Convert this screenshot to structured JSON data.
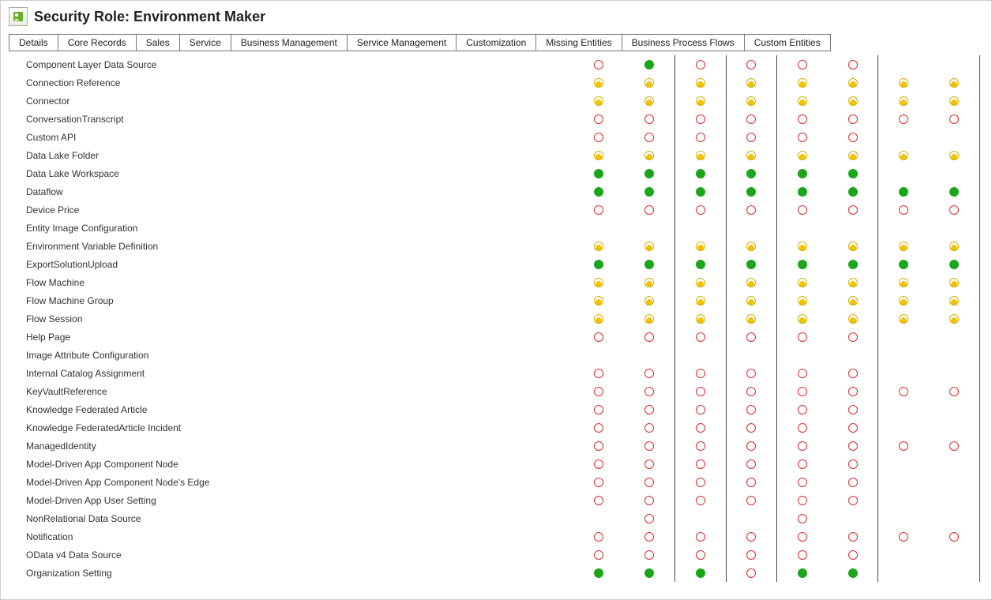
{
  "header": {
    "title": "Security Role: Environment Maker"
  },
  "tabs": [
    "Details",
    "Core Records",
    "Sales",
    "Service",
    "Business Management",
    "Service Management",
    "Customization",
    "Missing Entities",
    "Business Process Flows",
    "Custom Entities"
  ],
  "perm_legend": [
    "none",
    "user",
    "full",
    "blank"
  ],
  "entities": [
    {
      "name": "Component Layer Data Source",
      "perms": [
        "none",
        "full",
        "none",
        "none",
        "none",
        "none",
        "blank",
        "blank"
      ]
    },
    {
      "name": "Connection Reference",
      "perms": [
        "user",
        "user",
        "user",
        "user",
        "user",
        "user",
        "user",
        "user"
      ]
    },
    {
      "name": "Connector",
      "perms": [
        "user",
        "user",
        "user",
        "user",
        "user",
        "user",
        "user",
        "user"
      ]
    },
    {
      "name": "ConversationTranscript",
      "perms": [
        "none",
        "none",
        "none",
        "none",
        "none",
        "none",
        "none",
        "none"
      ]
    },
    {
      "name": "Custom API",
      "perms": [
        "none",
        "none",
        "none",
        "none",
        "none",
        "none",
        "blank",
        "blank"
      ]
    },
    {
      "name": "Data Lake Folder",
      "perms": [
        "user",
        "user",
        "user",
        "user",
        "user",
        "user",
        "user",
        "user"
      ]
    },
    {
      "name": "Data Lake Workspace",
      "perms": [
        "full",
        "full",
        "full",
        "full",
        "full",
        "full",
        "blank",
        "blank"
      ]
    },
    {
      "name": "Dataflow",
      "perms": [
        "full",
        "full",
        "full",
        "full",
        "full",
        "full",
        "full",
        "full"
      ]
    },
    {
      "name": "Device Price",
      "perms": [
        "none",
        "none",
        "none",
        "none",
        "none",
        "none",
        "none",
        "none"
      ]
    },
    {
      "name": "Entity Image Configuration",
      "perms": [
        "blank",
        "blank",
        "blank",
        "blank",
        "blank",
        "blank",
        "blank",
        "blank"
      ]
    },
    {
      "name": "Environment Variable Definition",
      "perms": [
        "user",
        "user",
        "user",
        "user",
        "user",
        "user",
        "user",
        "user"
      ]
    },
    {
      "name": "ExportSolutionUpload",
      "perms": [
        "full",
        "full",
        "full",
        "full",
        "full",
        "full",
        "full",
        "full"
      ]
    },
    {
      "name": "Flow Machine",
      "perms": [
        "user",
        "user",
        "user",
        "user",
        "user",
        "user",
        "user",
        "user"
      ]
    },
    {
      "name": "Flow Machine Group",
      "perms": [
        "user",
        "user",
        "user",
        "user",
        "user",
        "user",
        "user",
        "user"
      ]
    },
    {
      "name": "Flow Session",
      "perms": [
        "user",
        "user",
        "user",
        "user",
        "user",
        "user",
        "user",
        "user"
      ]
    },
    {
      "name": "Help Page",
      "perms": [
        "none",
        "none",
        "none",
        "none",
        "none",
        "none",
        "blank",
        "blank"
      ]
    },
    {
      "name": "Image Attribute Configuration",
      "perms": [
        "blank",
        "blank",
        "blank",
        "blank",
        "blank",
        "blank",
        "blank",
        "blank"
      ]
    },
    {
      "name": "Internal Catalog Assignment",
      "perms": [
        "none",
        "none",
        "none",
        "none",
        "none",
        "none",
        "blank",
        "blank"
      ]
    },
    {
      "name": "KeyVaultReference",
      "perms": [
        "none",
        "none",
        "none",
        "none",
        "none",
        "none",
        "none",
        "none"
      ]
    },
    {
      "name": "Knowledge Federated Article",
      "perms": [
        "none",
        "none",
        "none",
        "none",
        "none",
        "none",
        "blank",
        "blank"
      ]
    },
    {
      "name": "Knowledge FederatedArticle Incident",
      "perms": [
        "none",
        "none",
        "none",
        "none",
        "none",
        "none",
        "blank",
        "blank"
      ]
    },
    {
      "name": "ManagedIdentity",
      "perms": [
        "none",
        "none",
        "none",
        "none",
        "none",
        "none",
        "none",
        "none"
      ]
    },
    {
      "name": "Model-Driven App Component Node",
      "perms": [
        "none",
        "none",
        "none",
        "none",
        "none",
        "none",
        "blank",
        "blank"
      ]
    },
    {
      "name": "Model-Driven App Component Node's Edge",
      "perms": [
        "none",
        "none",
        "none",
        "none",
        "none",
        "none",
        "blank",
        "blank"
      ]
    },
    {
      "name": "Model-Driven App User Setting",
      "perms": [
        "none",
        "none",
        "none",
        "none",
        "none",
        "none",
        "blank",
        "blank"
      ]
    },
    {
      "name": "NonRelational Data Source",
      "perms": [
        "blank",
        "none",
        "blank",
        "blank",
        "none",
        "blank",
        "blank",
        "blank"
      ]
    },
    {
      "name": "Notification",
      "perms": [
        "none",
        "none",
        "none",
        "none",
        "none",
        "none",
        "none",
        "none"
      ]
    },
    {
      "name": "OData v4 Data Source",
      "perms": [
        "none",
        "none",
        "none",
        "none",
        "none",
        "none",
        "blank",
        "blank"
      ]
    },
    {
      "name": "Organization Setting",
      "perms": [
        "full",
        "full",
        "full",
        "none",
        "full",
        "full",
        "blank",
        "blank"
      ]
    }
  ]
}
